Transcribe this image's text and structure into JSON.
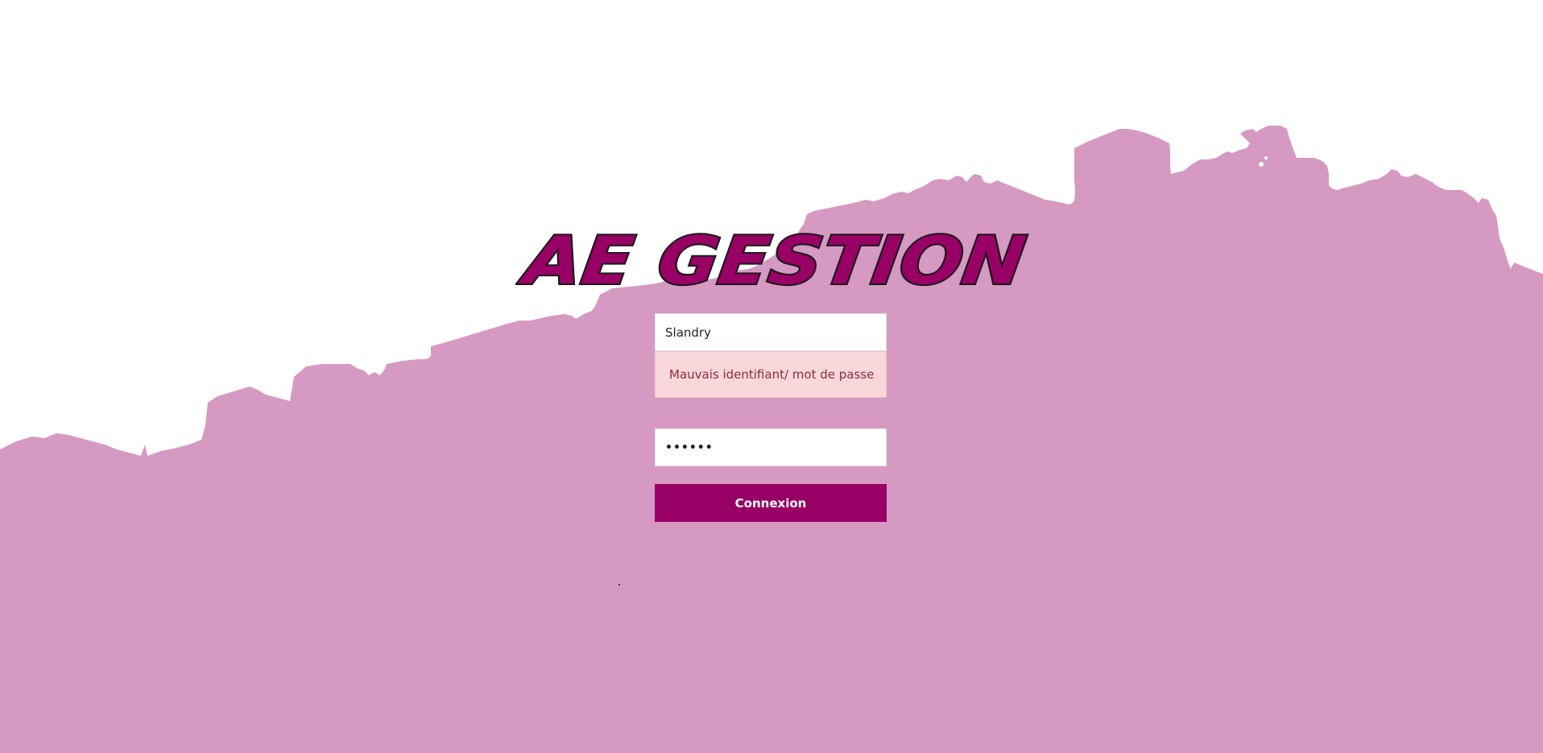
{
  "brand": {
    "logo_text": "AE GESTION",
    "logo_fill": "#990066",
    "logo_stroke": "#1a1a1a"
  },
  "background": {
    "shape_color": "#d699c2",
    "page_color": "#ffffff"
  },
  "login": {
    "username_value": "Slandry",
    "error_message": "Mauvais identifiant/ mot de passe",
    "password_value": "••••••",
    "submit_label": "Connexion",
    "accent_color": "#990066",
    "error_bg": "#f8d7da",
    "error_text_color": "#8a2f3b"
  }
}
